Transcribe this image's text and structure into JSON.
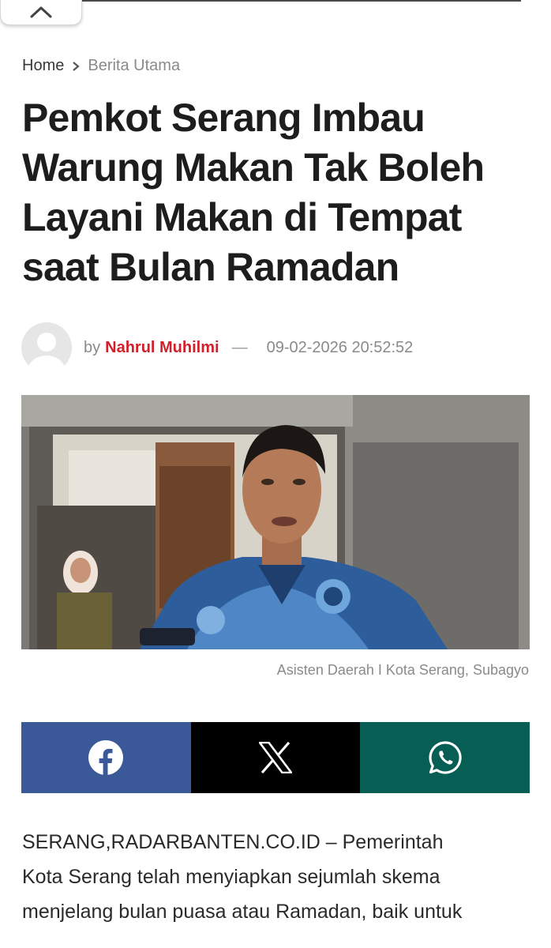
{
  "breadcrumb": {
    "home": "Home",
    "category": "Berita Utama"
  },
  "article": {
    "title": "Pemkot Serang Imbau Warung Makan Tak Boleh Layani Makan di Tempat saat Bulan Ramadan",
    "by_label": "by",
    "author": "Nahrul Muhilmi",
    "separator": "—",
    "datetime": "09-02-2026 20:52:52",
    "image_caption": "Asisten Daerah I Kota Serang, Subagyo",
    "body_lines": [
      "SERANG,RADARBANTEN.CO.ID – Pemerintah",
      "Kota Serang telah menyiapkan sejumlah skema",
      "menjelang bulan puasa atau Ramadan, baik untuk"
    ]
  },
  "share": [
    {
      "network": "facebook",
      "icon": "facebook-icon",
      "color": "#3b5998"
    },
    {
      "network": "x",
      "icon": "x-icon",
      "color": "#000000"
    },
    {
      "network": "whatsapp",
      "icon": "whatsapp-icon",
      "color": "#075e54"
    }
  ],
  "colors": {
    "author": "#d21f2a",
    "muted": "#8a8a8a",
    "title": "#1d1d1d"
  },
  "icons": {
    "close": "chevron-up-icon",
    "breadcrumb_separator": "chevron-right-icon"
  }
}
